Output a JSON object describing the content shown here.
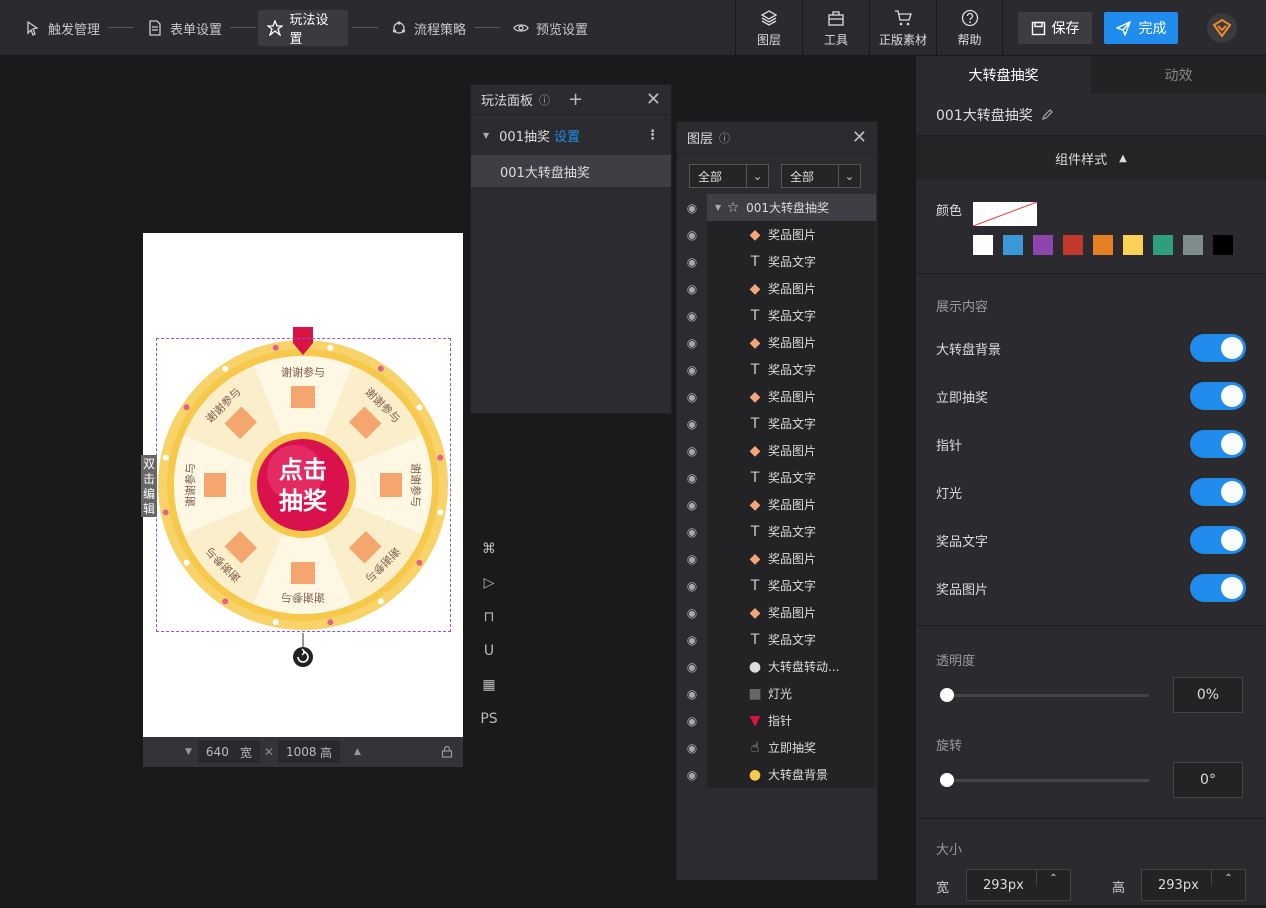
{
  "steps": [
    {
      "label": "触发管理",
      "icon": "trigger-icon"
    },
    {
      "label": "表单设置",
      "icon": "form-icon"
    },
    {
      "label": "玩法设置",
      "icon": "star-icon",
      "active": true
    },
    {
      "label": "流程策略",
      "icon": "flow-icon"
    },
    {
      "label": "预览设置",
      "icon": "eye-icon"
    }
  ],
  "tools": [
    {
      "label": "图层",
      "icon": "layers-icon"
    },
    {
      "label": "工具",
      "icon": "toolbox-icon"
    },
    {
      "label": "正版素材",
      "icon": "cart-icon"
    },
    {
      "label": "帮助",
      "icon": "help-icon"
    }
  ],
  "actions": {
    "save": "保存",
    "done": "完成"
  },
  "canvas": {
    "side_tag": "双击编辑",
    "width": "640",
    "width_unit": "宽",
    "height": "1008",
    "height_unit": "高",
    "button_text": "点击抽奖",
    "segment_text": "谢谢参与"
  },
  "vtools": [
    "⌘",
    "▷",
    "⊓",
    "U",
    "▦",
    "PS"
  ],
  "play_panel": {
    "title": "玩法面板",
    "group": "001抽奖",
    "group_link": "设置",
    "item": "001大转盘抽奖"
  },
  "layer_panel": {
    "title": "图层",
    "filter1": "全部",
    "filter2": "全部",
    "root": "001大转盘抽奖",
    "rows": [
      {
        "label": "奖品图片",
        "type": "image"
      },
      {
        "label": "奖品文字",
        "type": "text"
      },
      {
        "label": "奖品图片",
        "type": "image"
      },
      {
        "label": "奖品文字",
        "type": "text"
      },
      {
        "label": "奖品图片",
        "type": "image"
      },
      {
        "label": "奖品文字",
        "type": "text"
      },
      {
        "label": "奖品图片",
        "type": "image"
      },
      {
        "label": "奖品文字",
        "type": "text"
      },
      {
        "label": "奖品图片",
        "type": "image"
      },
      {
        "label": "奖品文字",
        "type": "text"
      },
      {
        "label": "奖品图片",
        "type": "image"
      },
      {
        "label": "奖品文字",
        "type": "text"
      },
      {
        "label": "奖品图片",
        "type": "image"
      },
      {
        "label": "奖品文字",
        "type": "text"
      },
      {
        "label": "奖品图片",
        "type": "image"
      },
      {
        "label": "奖品文字",
        "type": "text"
      },
      {
        "label": "大转盘转动...",
        "type": "anim"
      },
      {
        "label": "灯光",
        "type": "light"
      },
      {
        "label": "指针",
        "type": "pointer"
      },
      {
        "label": "立即抽奖",
        "type": "hand"
      },
      {
        "label": "大转盘背景",
        "type": "bg"
      }
    ]
  },
  "right_panel": {
    "tab_active": "大转盘抽奖",
    "tab_other": "动效",
    "name": "001大转盘抽奖",
    "section": "组件样式",
    "color_label": "颜色",
    "swatches": [
      "#ffffff",
      "#3b98d8",
      "#8e44ad",
      "#c0392b",
      "#e67e22",
      "#f9d154",
      "#2e9e7e",
      "#7f8c8d",
      "#000000"
    ],
    "display_title": "展示内容",
    "toggles": [
      "大转盘背景",
      "立即抽奖",
      "指针",
      "灯光",
      "奖品文字",
      "奖品图片"
    ],
    "opacity_label": "透明度",
    "opacity_value": "0%",
    "rotate_label": "旋转",
    "rotate_value": "0°",
    "size_label": "大小",
    "w_label": "宽",
    "w_value": "293px",
    "h_label": "高",
    "h_value": "293px"
  }
}
